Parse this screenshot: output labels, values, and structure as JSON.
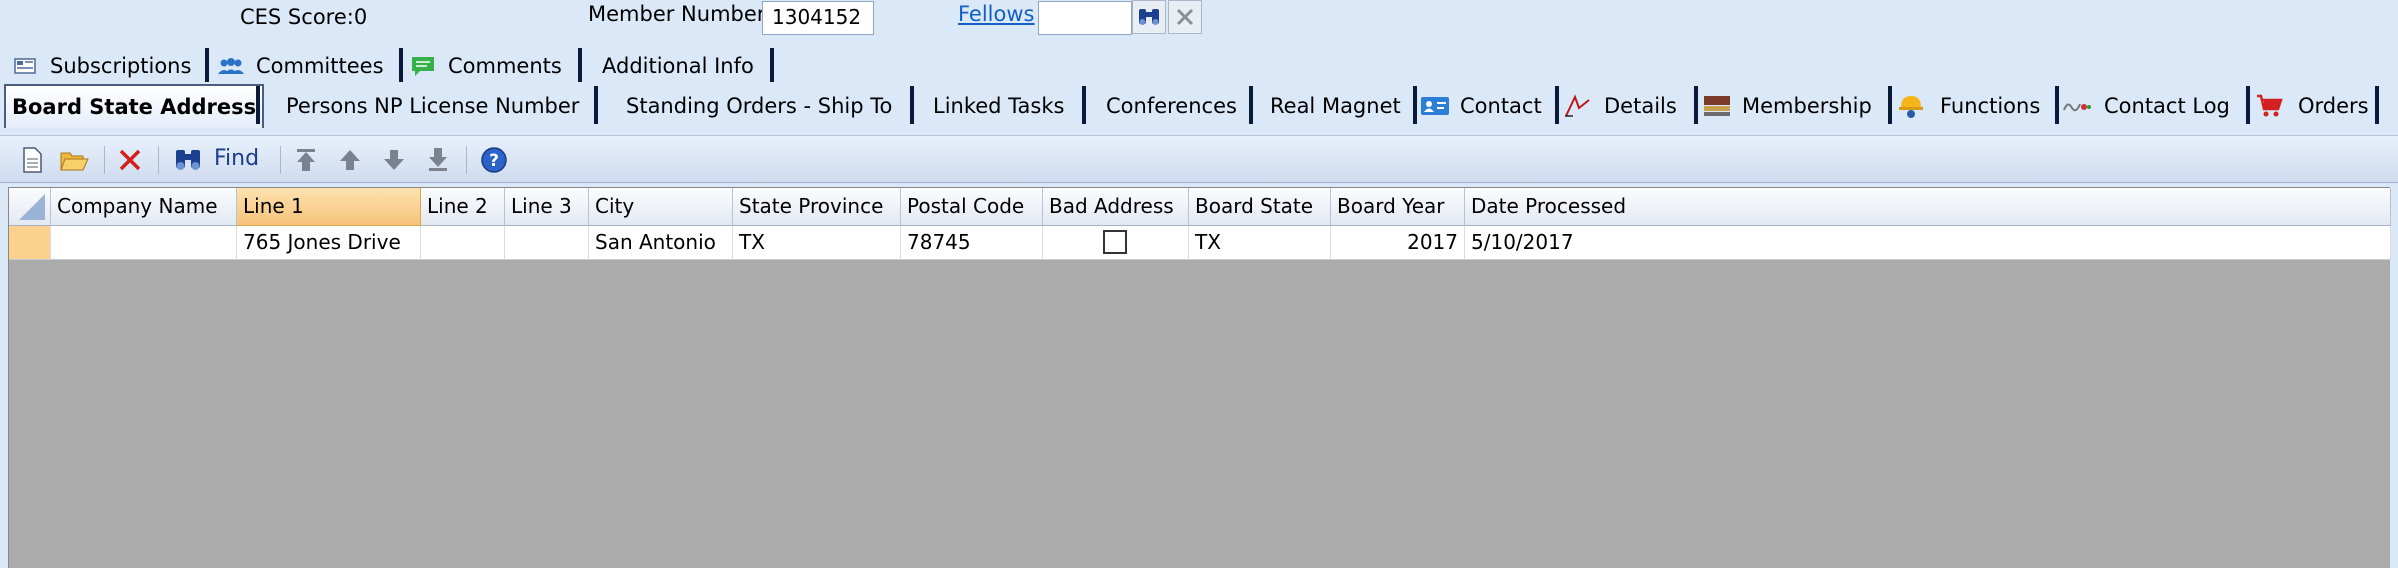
{
  "header": {
    "ces_score": "CES Score:0",
    "member_number_label": "Member Number",
    "member_number_value": "1304152",
    "fellows_link": "Fellows",
    "fellows_value": ""
  },
  "tabs_row1": [
    {
      "label": "Subscriptions",
      "icon": "subscriptions-icon"
    },
    {
      "label": "Committees",
      "icon": "people-icon"
    },
    {
      "label": "Comments",
      "icon": "comment-icon"
    },
    {
      "label": "Additional Info",
      "icon": ""
    }
  ],
  "tabs_row2": [
    {
      "label": "Board State Address",
      "selected": true
    },
    {
      "label": "Persons NP License Number"
    },
    {
      "label": "Standing Orders - Ship To"
    },
    {
      "label": "Linked Tasks"
    },
    {
      "label": "Conferences"
    },
    {
      "label": "Real Magnet"
    },
    {
      "label": "Contact",
      "icon": "contact-card-icon"
    },
    {
      "label": "Details",
      "icon": "pen-icon"
    },
    {
      "label": "Membership",
      "icon": "membership-icon"
    },
    {
      "label": "Functions",
      "icon": "hardhat-icon"
    },
    {
      "label": "Contact Log",
      "icon": "contact-log-icon"
    },
    {
      "label": "Orders",
      "icon": "cart-icon"
    }
  ],
  "toolbar": {
    "find_label": "Find"
  },
  "grid": {
    "columns": [
      "Company Name",
      "Line 1",
      "Line 2",
      "Line 3",
      "City",
      "State Province",
      "Postal Code",
      "Bad Address",
      "Board State",
      "Board Year",
      "Date Processed"
    ],
    "sorted_column": "Line 1",
    "rows": [
      {
        "company_name": "",
        "line1": "765 Jones Drive",
        "line2": "",
        "line3": "",
        "city": "San Antonio",
        "state_province": "TX",
        "postal_code": "78745",
        "bad_address": false,
        "board_state": "TX",
        "board_year": "2017",
        "date_processed": "5/10/2017"
      }
    ]
  },
  "colors": {
    "background": "#dbe8f8",
    "grid_empty": "#ababab",
    "selected_row": "#fcd18d",
    "link": "#1060c8"
  }
}
